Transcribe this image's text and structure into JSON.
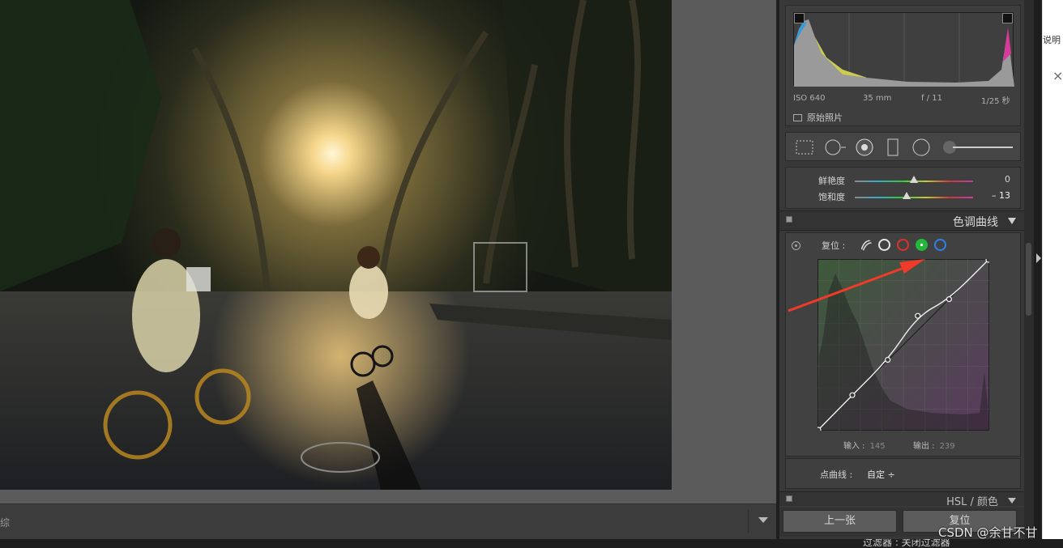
{
  "filmstrip": {
    "left_label": "综"
  },
  "histogram": {
    "iso": "ISO 640",
    "focal": "35 mm",
    "aperture": "f / 11",
    "shutter": "1/25 秒",
    "original_photo": "原始照片"
  },
  "basic": {
    "vibrance": {
      "label": "鲜艳度",
      "value": "0",
      "level": 0
    },
    "saturation": {
      "label": "饱和度",
      "value": "– 13",
      "level": -13
    }
  },
  "tone_curve": {
    "title": "色调曲线",
    "reset": "复位 :",
    "input_label": "输入 :",
    "input_value": "145",
    "output_label": "输出 :",
    "output_value": "239",
    "point_curve_label": "点曲线 :",
    "point_curve_value": "自定 ÷",
    "points": [
      [
        0,
        0
      ],
      [
        51,
        52
      ],
      [
        104,
        105
      ],
      [
        149,
        171
      ],
      [
        196,
        196
      ],
      [
        255,
        255
      ]
    ],
    "colors": {
      "red": "#e0302a",
      "green": "#22b83a",
      "blue": "#2f7fe8"
    }
  },
  "hsl": {
    "title": "HSL / 颜色"
  },
  "buttons": {
    "previous": "上一张",
    "reset": "复位"
  },
  "bottom": {
    "filter_text": "过滤器 : 关闭过滤器"
  },
  "external": {
    "right_text": "说明"
  },
  "watermark": "CSDN @余甘不甘"
}
